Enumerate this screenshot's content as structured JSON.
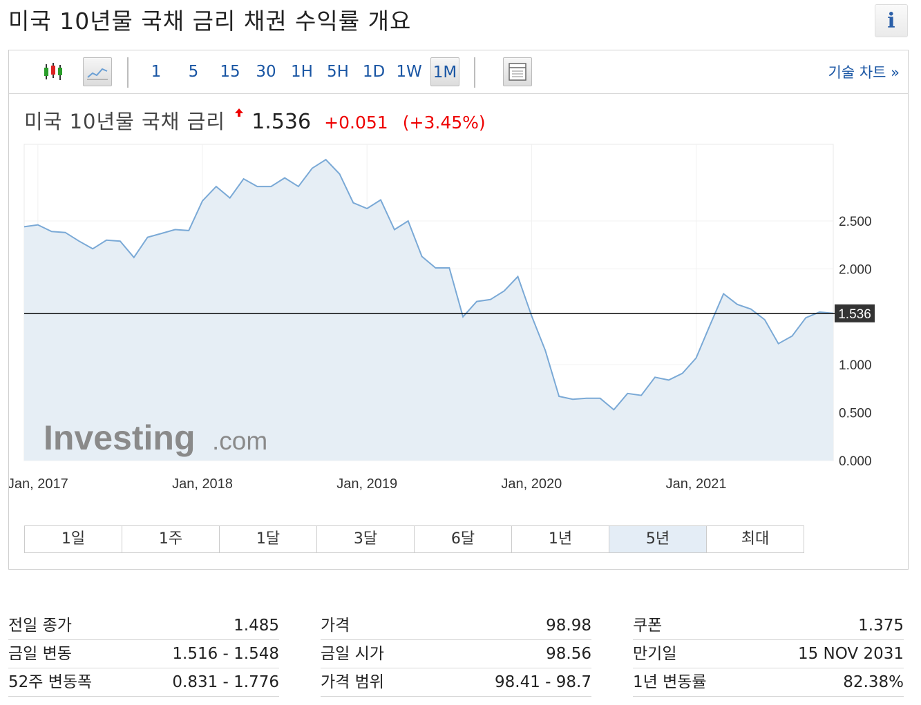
{
  "page": {
    "title": "미국 10년물 국채 금리  채권 수익률 개요",
    "info_icon": "info-icon"
  },
  "toolbar": {
    "icons": [
      "candlestick-icon",
      "line-chart-icon",
      "layout-icon"
    ],
    "timeframes": [
      "1",
      "5",
      "15",
      "30",
      "1H",
      "5H",
      "1D",
      "1W",
      "1M"
    ],
    "active_timeframe": "1M",
    "tech_chart_link": "기술 차트 »"
  },
  "quote": {
    "name": "미국 10년물 국채 금리",
    "price": "1.536",
    "change": "+0.051",
    "change_pct": "(+3.45%)",
    "direction": "up"
  },
  "watermark": {
    "brand": "Investing",
    "suffix": ".com"
  },
  "chart_data": {
    "type": "area",
    "x_start": "2016-12",
    "x_step": "1 month",
    "x_ticks": [
      "Jan, 2017",
      "Jan, 2018",
      "Jan, 2019",
      "Jan, 2020",
      "Jan, 2021"
    ],
    "y_ticks": [
      "0.000",
      "0.500",
      "1.000",
      "2.000",
      "2.500"
    ],
    "ylim": [
      0,
      3.3
    ],
    "current_value": 1.536,
    "current_label": "1.536",
    "colors": {
      "line": "#7aa9d6",
      "fill": "#e6eef5",
      "current_line": "#000000",
      "current_label_bg": "#333333"
    },
    "series": [
      {
        "values": [
          2.44,
          2.46,
          2.39,
          2.38,
          2.29,
          2.21,
          2.3,
          2.29,
          2.12,
          2.33,
          2.37,
          2.41,
          2.4,
          2.71,
          2.86,
          2.74,
          2.94,
          2.86,
          2.86,
          2.95,
          2.86,
          3.05,
          3.14,
          2.99,
          2.69,
          2.63,
          2.72,
          2.41,
          2.5,
          2.13,
          2.01,
          2.01,
          1.5,
          1.66,
          1.68,
          1.77,
          1.92,
          1.51,
          1.15,
          0.67,
          0.64,
          0.65,
          0.65,
          0.53,
          0.7,
          0.68,
          0.87,
          0.84,
          0.91,
          1.07,
          1.41,
          1.74,
          1.63,
          1.58,
          1.47,
          1.22,
          1.3,
          1.49,
          1.55,
          1.536
        ]
      }
    ]
  },
  "ranges": [
    "1일",
    "1주",
    "1달",
    "3달",
    "6달",
    "1년",
    "5년",
    "최대"
  ],
  "active_range": "5년",
  "stats": [
    [
      {
        "label": "전일 종가",
        "value": "1.485"
      },
      {
        "label": "금일 변동",
        "value": "1.516 - 1.548"
      },
      {
        "label": "52주 변동폭",
        "value": "0.831 - 1.776"
      }
    ],
    [
      {
        "label": "가격",
        "value": "98.98"
      },
      {
        "label": "금일 시가",
        "value": "98.56"
      },
      {
        "label": "가격 범위",
        "value": "98.41 - 98.7"
      }
    ],
    [
      {
        "label": "쿠폰",
        "value": "1.375"
      },
      {
        "label": "만기일",
        "value": "15 NOV 2031"
      },
      {
        "label": "1년 변동률",
        "value": "82.38%"
      }
    ]
  ]
}
